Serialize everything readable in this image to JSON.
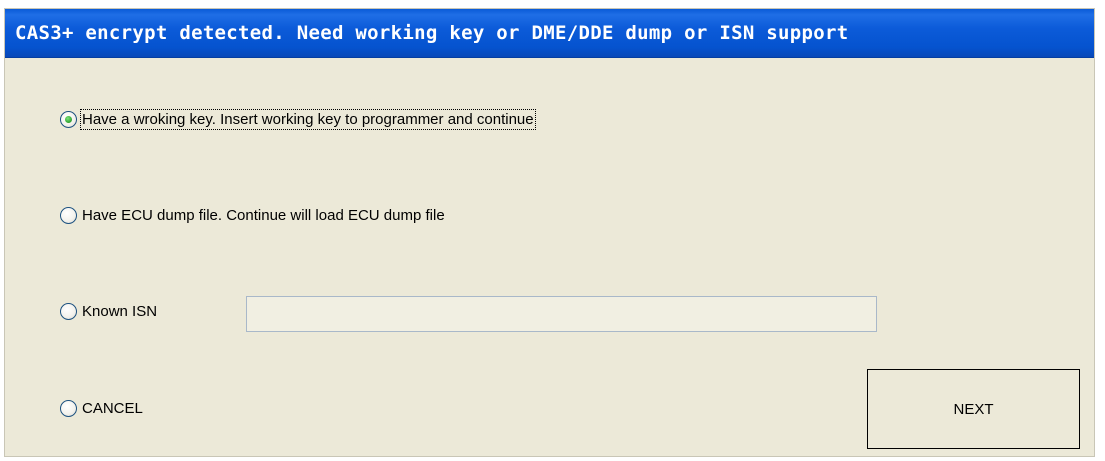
{
  "window": {
    "title": "CAS3+ encrypt detected. Need working key or DME/DDE dump or ISN support"
  },
  "options": [
    {
      "label": "Have a wroking key. Insert working key to programmer and continue",
      "checked": true
    },
    {
      "label": "Have ECU dump file. Continue will load ECU dump file",
      "checked": false
    },
    {
      "label": "Known ISN",
      "checked": false
    },
    {
      "label": "CANCEL",
      "checked": false
    }
  ],
  "isn_input": {
    "value": ""
  },
  "next_button": {
    "label": "NEXT"
  }
}
